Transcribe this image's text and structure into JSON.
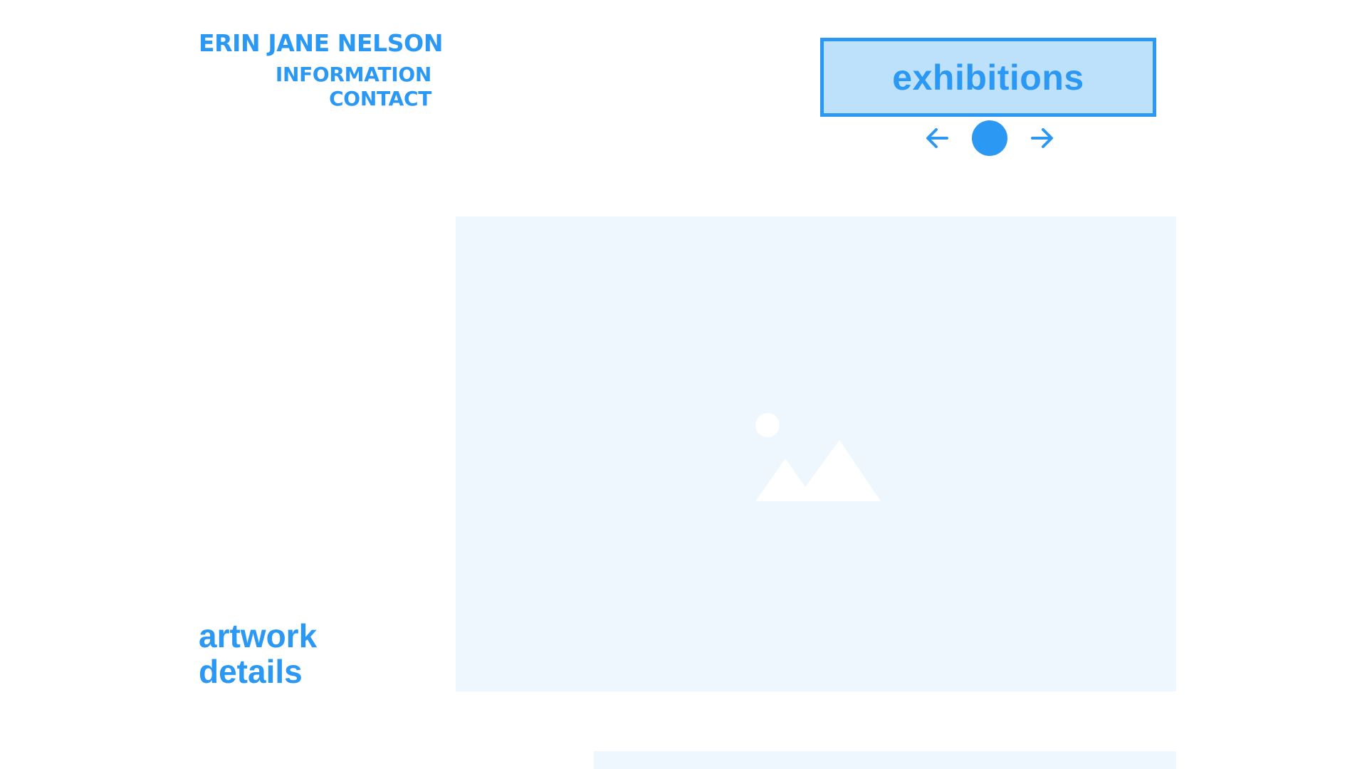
{
  "site": {
    "title": "ERIN JANE NELSON"
  },
  "nav": {
    "items": [
      {
        "label": "INFORMATION"
      },
      {
        "label": "CONTACT"
      }
    ]
  },
  "section": {
    "label": "exhibitions"
  },
  "slider": {
    "prev_icon": "arrow-left-icon",
    "next_icon": "arrow-right-icon",
    "current_indicator": "dot"
  },
  "artwork": {
    "placeholder_icon": "image-placeholder-icon",
    "caption": "artwork\ndetails"
  },
  "colors": {
    "accent": "#2b98f4",
    "section_fill": "#bde1fb",
    "image_placeholder": "#eef7fe",
    "background": "#ffffff"
  }
}
